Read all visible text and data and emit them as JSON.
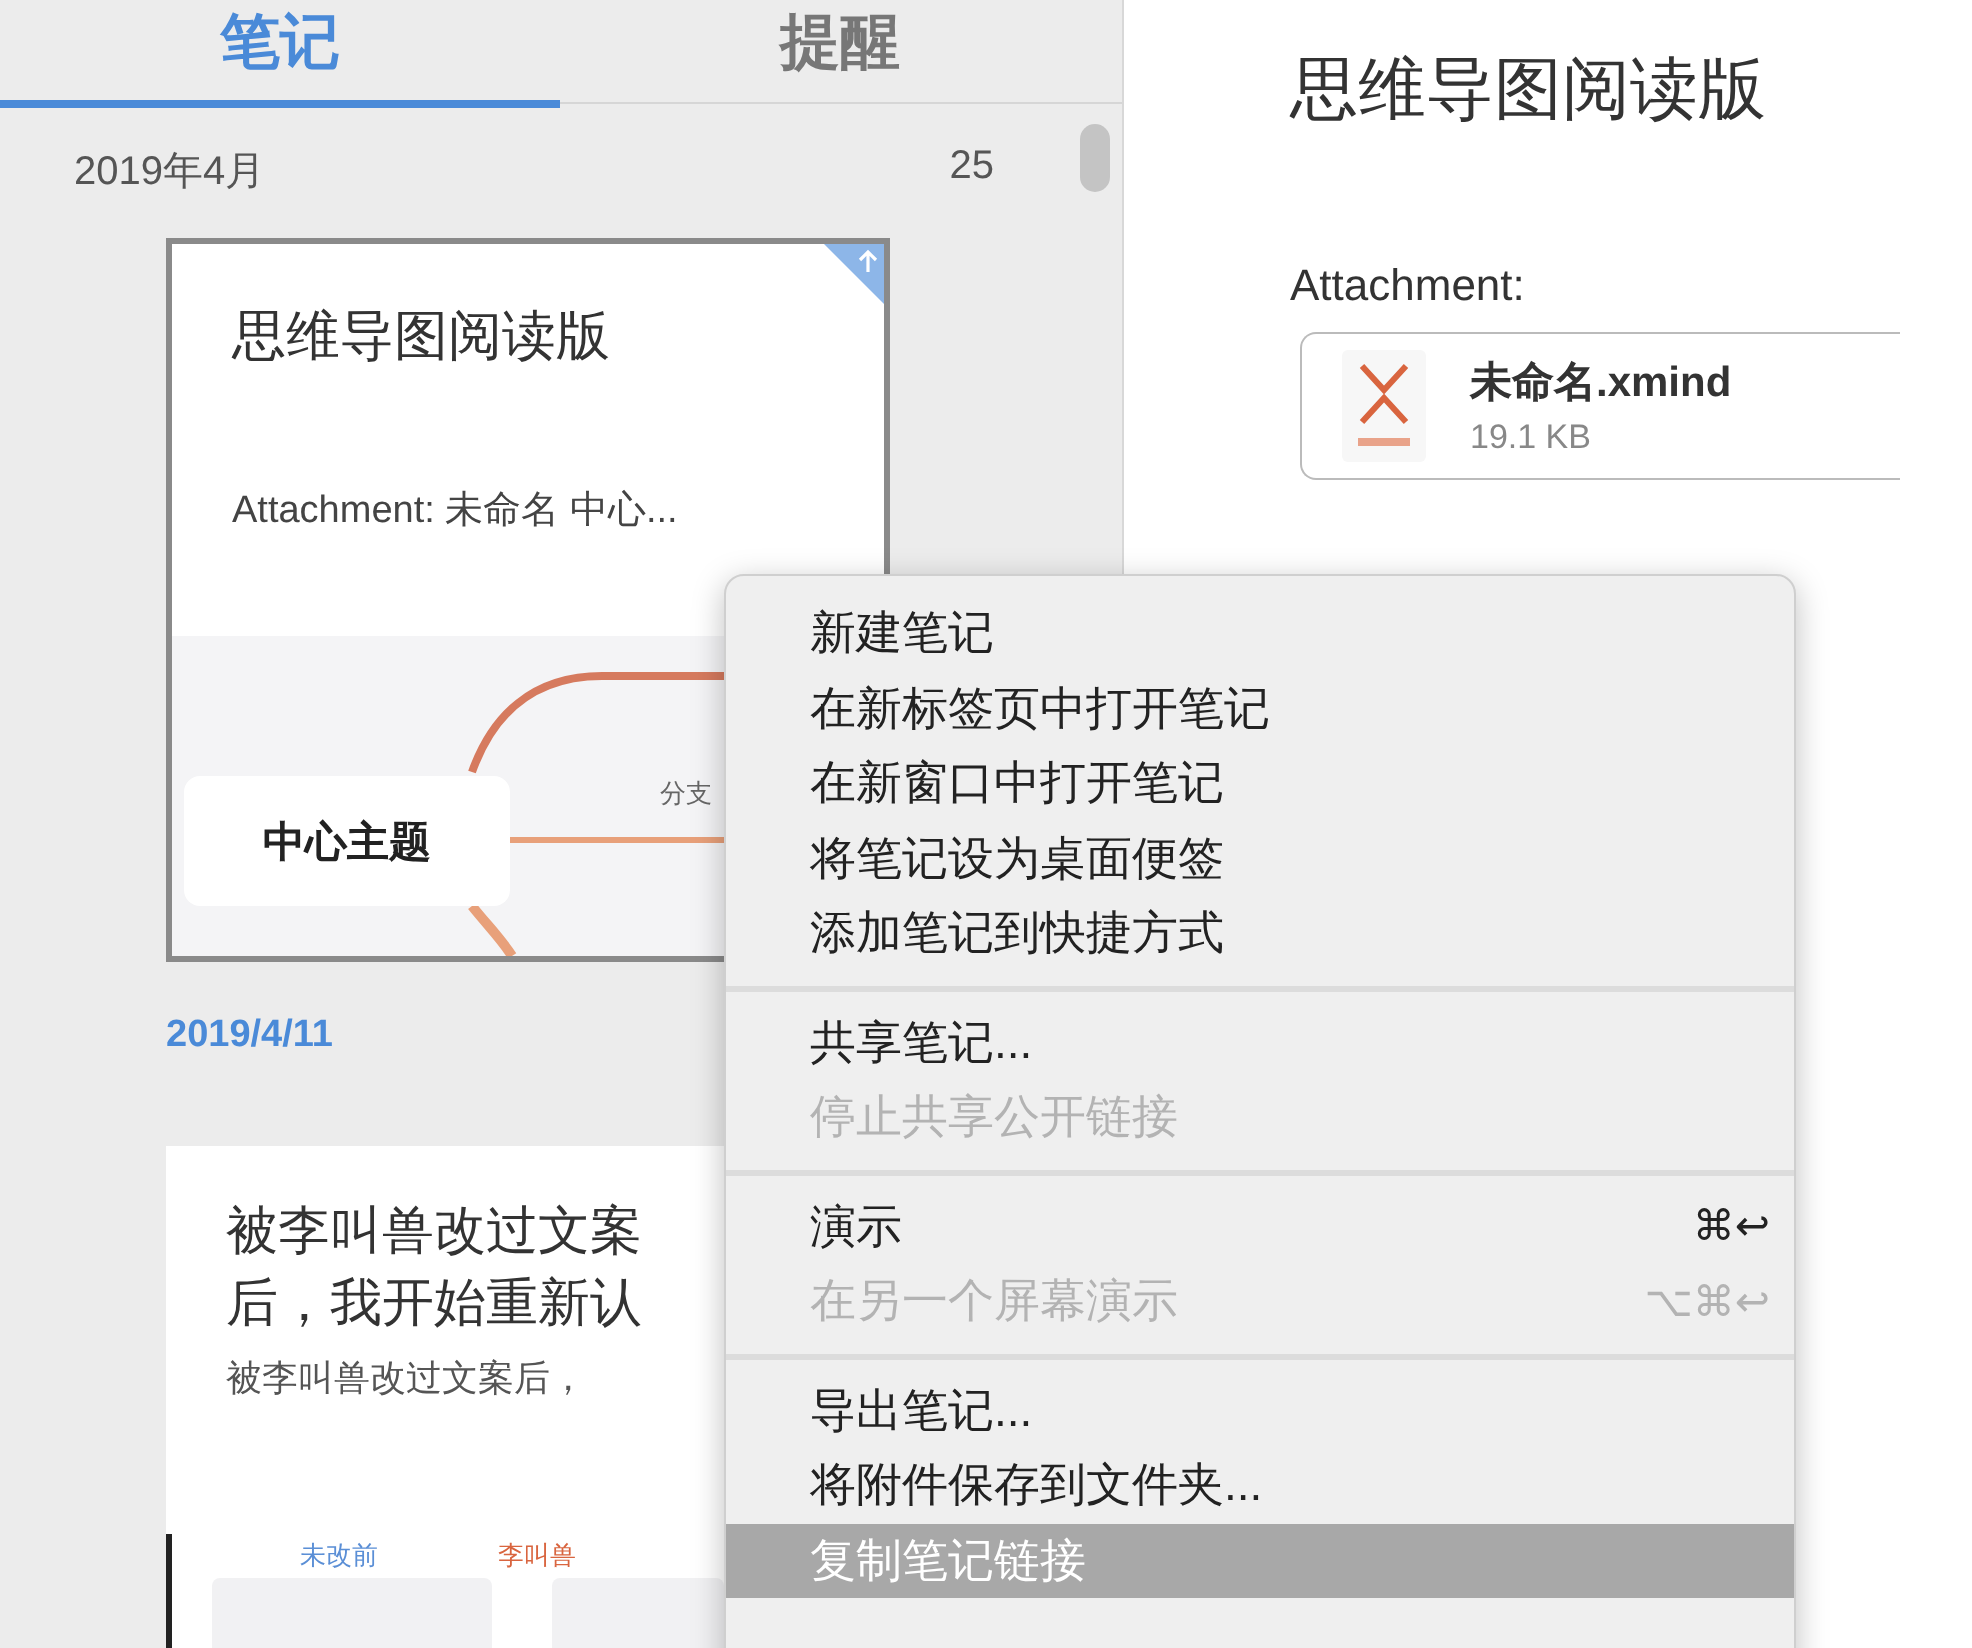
{
  "tabs": [
    {
      "label": "笔记",
      "selected": true
    },
    {
      "label": "提醒",
      "selected": false
    }
  ],
  "note_list": {
    "month": "2019年4月",
    "count": "25",
    "notes": [
      {
        "kind": "mindmap",
        "title": "思维导图阅读版",
        "snippet": "Attachment: 未命名 中心...",
        "synced": true,
        "center_topic": "中心主题",
        "branch": "分支",
        "date": "2019/4/11"
      },
      {
        "kind": "text",
        "title_lines": [
          "被李叫兽改过文案",
          "后，我开始重新认"
        ],
        "snippet": "被李叫兽改过文案后，",
        "thumb_labels": [
          {
            "text": "未改前",
            "color": "#5b8fd6"
          },
          {
            "text": "李叫兽",
            "color": "#d9653f"
          }
        ]
      }
    ]
  },
  "note_view": {
    "title": "思维导图阅读版",
    "attachment_label": "Attachment:",
    "attachment": {
      "name": "未命名.xmind",
      "size": "19.1 KB"
    }
  },
  "context_menu": {
    "groups": [
      {
        "items": [
          {
            "label": "新建笔记",
            "disabled": false,
            "selected": false
          },
          {
            "label": "在新标签页中打开笔记",
            "disabled": false,
            "selected": false
          },
          {
            "label": "在新窗口中打开笔记",
            "disabled": false,
            "selected": false
          },
          {
            "label": "将笔记设为桌面便签",
            "disabled": false,
            "selected": false
          },
          {
            "label": "添加笔记到快捷方式",
            "disabled": false,
            "selected": false
          }
        ]
      },
      {
        "items": [
          {
            "label": "共享笔记...",
            "disabled": false,
            "selected": false
          },
          {
            "label": "停止共享公开链接",
            "disabled": true,
            "selected": false
          }
        ]
      },
      {
        "items": [
          {
            "label": "演示",
            "shortcut": "⌘↩",
            "disabled": false,
            "selected": false
          },
          {
            "label": "在另一个屏幕演示",
            "shortcut": "⌥⌘↩",
            "disabled": true,
            "selected": false
          }
        ]
      },
      {
        "items": [
          {
            "label": "导出笔记...",
            "disabled": false,
            "selected": false
          },
          {
            "label": "将附件保存到文件夹...",
            "disabled": false,
            "selected": false
          },
          {
            "label": "复制笔记链接",
            "disabled": false,
            "selected": true
          }
        ]
      }
    ]
  }
}
